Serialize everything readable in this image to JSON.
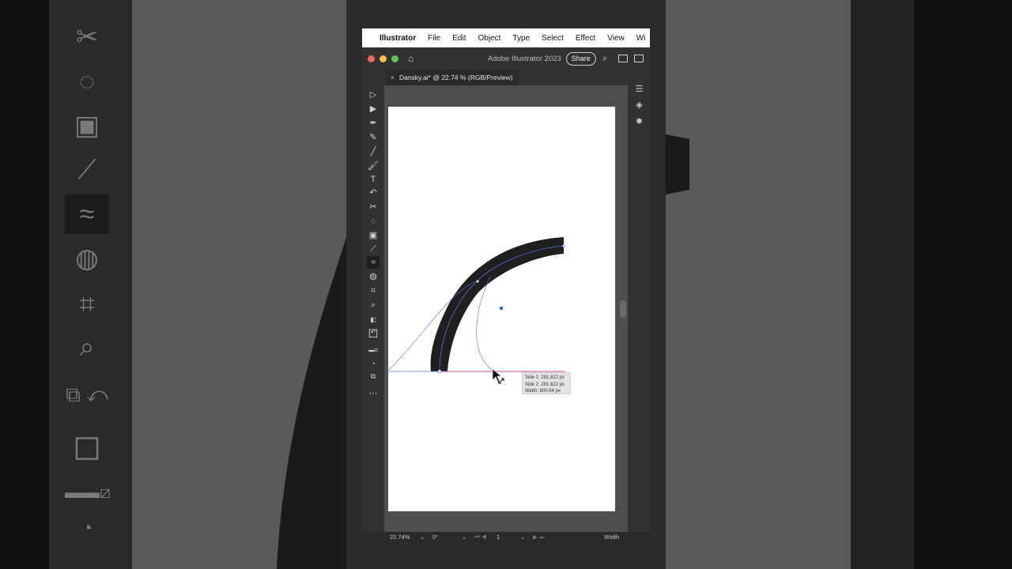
{
  "menubar": {
    "app_name": "Illustrator",
    "items": [
      "File",
      "Edit",
      "Object",
      "Type",
      "Select",
      "Effect",
      "View",
      "Wi"
    ]
  },
  "titlebar": {
    "app_title": "Adobe Illustrator 2023",
    "share_label": "Share"
  },
  "document": {
    "tab_label": "Dansky.ai* @ 22.74 % (RGB/Preview)"
  },
  "tools": [
    "selection-tool",
    "direct-selection-tool",
    "pen-tool",
    "curvature-tool",
    "line-tool",
    "paintbrush-tool",
    "type-tool",
    "rotate-tool",
    "scissors-tool",
    "lasso-tool",
    "gradient-tool",
    "eyedropper-tool",
    "width-tool",
    "shape-builder-tool",
    "artboard-tool",
    "zoom-tool"
  ],
  "measure_tooltip": {
    "side1": "Side 1: 281.822 px",
    "side2": "Side 2: 281.822 px",
    "width": "Width: 600.64 px"
  },
  "statusbar": {
    "zoom": "22.74%",
    "rotation": "0°",
    "artboard": "1",
    "tool_name": "Width"
  },
  "colors": {
    "fill": "#ffffff",
    "stroke": "#000000",
    "shape": "#1f1f1f",
    "path_outline": "#5b6fd6",
    "width_guide": "#c94aa0"
  }
}
